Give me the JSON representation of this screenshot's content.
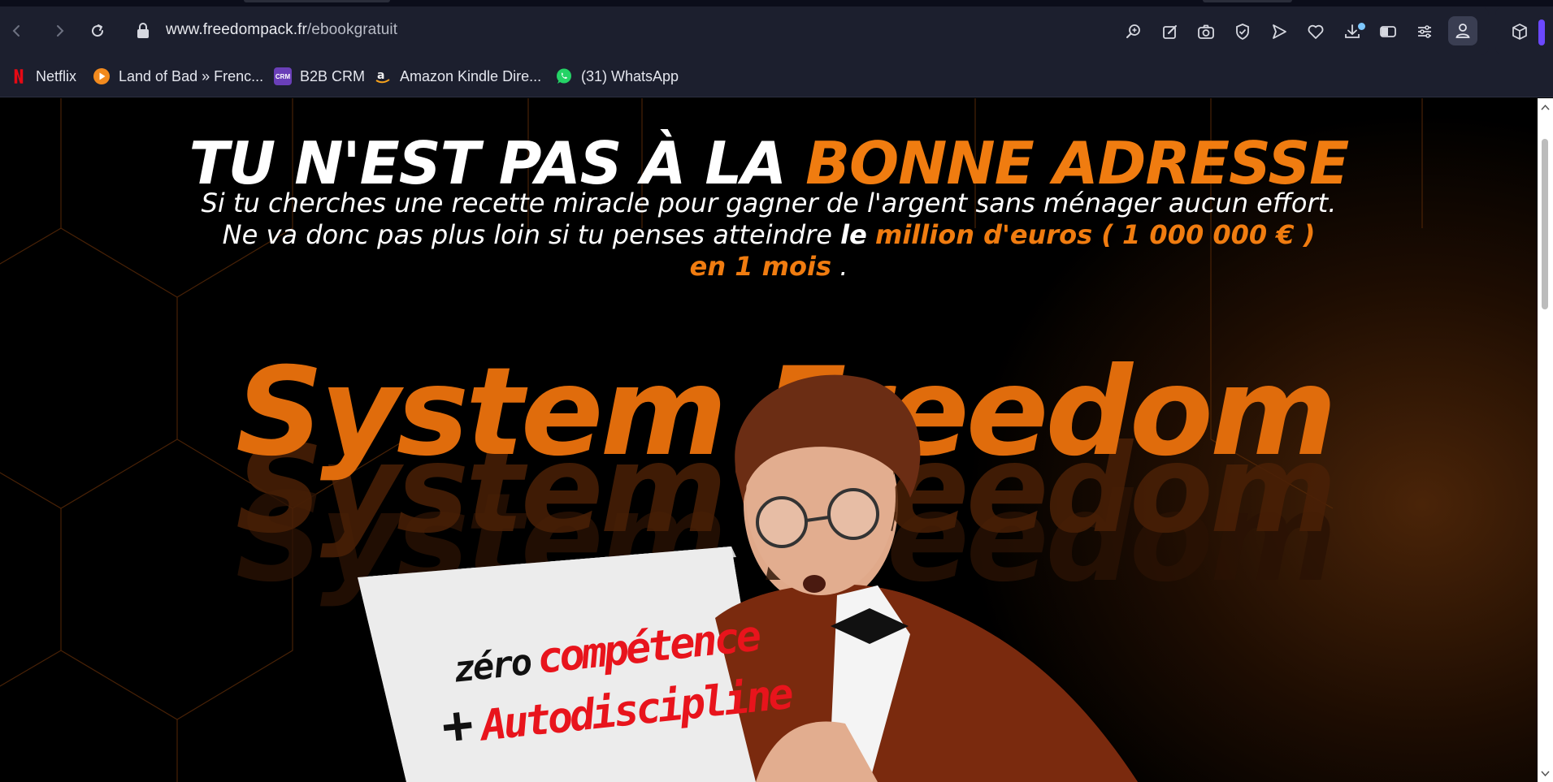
{
  "browser": {
    "url_host": "www.freedompack.fr",
    "url_path": "/ebookgratuit"
  },
  "bookmarks": [
    {
      "label": "Netflix",
      "icon": "netflix-icon"
    },
    {
      "label": "Land of Bad » Frenc...",
      "icon": "play-icon"
    },
    {
      "label": "B2B CRM",
      "icon": "crm-icon",
      "icon_text": "CRM"
    },
    {
      "label": "Amazon Kindle Dire...",
      "icon": "amazon-icon"
    },
    {
      "label": "(31) WhatsApp",
      "icon": "whatsapp-icon"
    }
  ],
  "hero": {
    "headline_white": "TU N'EST PAS À LA",
    "headline_orange": "BONNE ADRESSE",
    "line1": "Si tu cherches une recette miracle pour gagner de l'argent sans ménager aucun effort.",
    "line2_start": "Ne va donc pas plus loin si tu penses atteindre",
    "line2_bold": "le",
    "line2_orange": "million d'euros ( 1 000 000 € )",
    "line3_orange": "en 1 mois",
    "line3_end": ".",
    "brand_text": "System Freedom",
    "laptop_word1": "zéro",
    "laptop_word2": "compétence",
    "laptop_plus": "+",
    "laptop_word3": "Autodiscipline"
  },
  "colors": {
    "accent": "#f07c10",
    "toolbar_bg": "#1c1f2e",
    "profile_accent": "#6b48ff",
    "laptop_red": "#e8141c"
  }
}
